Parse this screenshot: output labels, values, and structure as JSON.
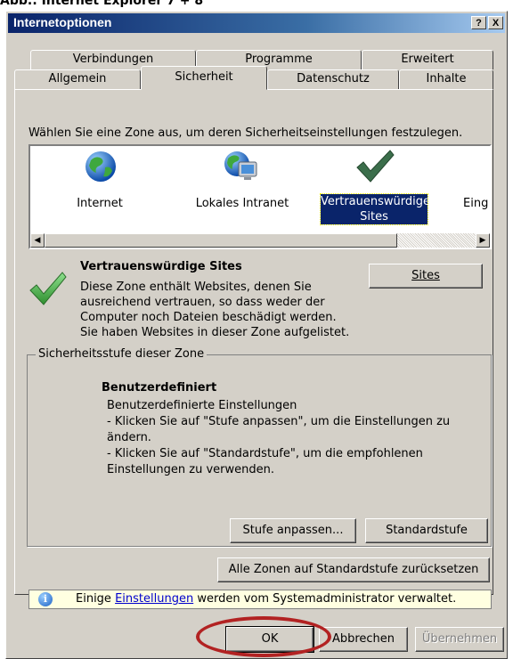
{
  "caption": "Abb.: Internet Explorer 7 + 8",
  "window": {
    "title": "Internetoptionen",
    "help_btn": "?",
    "close_btn": "X"
  },
  "tabs_row1": [
    "Verbindungen",
    "Programme",
    "Erweitert"
  ],
  "tabs_row2": [
    "Allgemein",
    "Sicherheit",
    "Datenschutz",
    "Inhalte"
  ],
  "active_tab": "Sicherheit",
  "zone_prompt": "Wählen Sie eine Zone aus, um deren Sicherheitseinstellungen festzulegen.",
  "zones": [
    {
      "label": "Internet",
      "icon": "globe-icon"
    },
    {
      "label": "Lokales Intranet",
      "icon": "intranet-icon"
    },
    {
      "label_line1": "Vertrauenswürdige",
      "label_line2": "Sites",
      "icon": "checkmark-icon",
      "selected": true
    },
    {
      "label": "Eing",
      "icon": "restricted-icon"
    }
  ],
  "zone_info": {
    "title": "Vertrauenswürdige Sites",
    "line1": "Diese Zone enthält Websites, denen Sie",
    "line2": "ausreichend vertrauen, so dass weder der",
    "line3": "Computer noch Dateien beschädigt werden.",
    "line4": "Sie haben Websites in dieser Zone aufgelistet."
  },
  "sites_button": "Sites",
  "security_group": {
    "legend": "Sicherheitsstufe dieser Zone",
    "level_title": "Benutzerdefiniert",
    "line1": "Benutzerdefinierte Einstellungen",
    "line2": "- Klicken Sie auf \"Stufe anpassen\", um die Einstellungen zu",
    "line3": "ändern.",
    "line4": "- Klicken Sie auf \"Standardstufe\", um die empfohlenen",
    "line5": "Einstellungen zu verwenden."
  },
  "buttons": {
    "custom_level": "Stufe anpassen...",
    "default_level": "Standardstufe",
    "reset_all": "Alle Zonen auf Standardstufe zurücksetzen",
    "ok": "OK",
    "cancel": "Abbrechen",
    "apply": "Übernehmen"
  },
  "infobar": {
    "prefix": "Einige",
    "link": "Einstellungen",
    "suffix": "werden vom Systemadministrator verwaltet."
  },
  "colors": {
    "title_bar": "#0a246a",
    "selection": "#0a246a",
    "highlight_ring": "#b22222",
    "check_green": "#3a8a3a",
    "dialog_bg": "#d4d0c8"
  }
}
